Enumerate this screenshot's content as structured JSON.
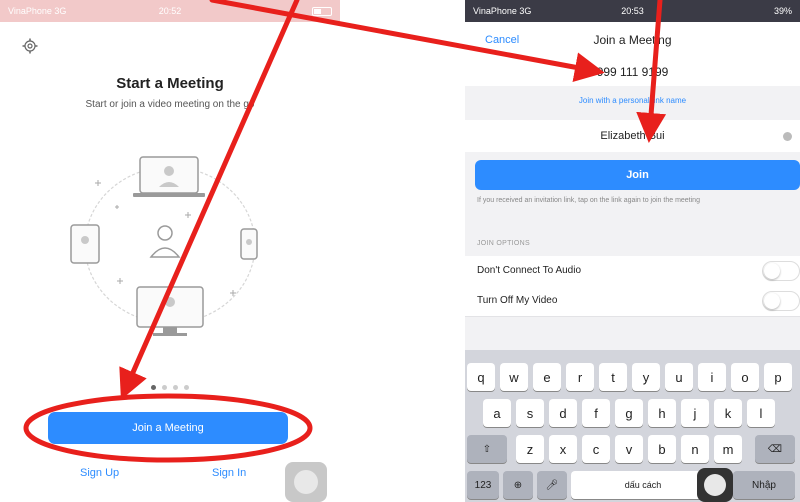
{
  "left": {
    "status": {
      "carrier": "VinaPhone 3G",
      "time": "20:52"
    },
    "title": "Start a Meeting",
    "subtitle": "Start or join a video meeting on the go",
    "pager": {
      "count": 4,
      "active": 0
    },
    "join_meeting_label": "Join a Meeting",
    "sign_up_label": "Sign Up",
    "sign_in_label": "Sign In"
  },
  "right": {
    "status": {
      "carrier": "VinaPhone 3G",
      "time": "20:53",
      "battery": "39%"
    },
    "cancel_label": "Cancel",
    "title": "Join a Meeting",
    "meeting_id": "999 111 9199",
    "personal_link_label": "Join with a personal link name",
    "name_value": "Elizabeth Bui",
    "join_label": "Join",
    "hint": "If you received an invitation link, tap on the link again to join the meeting",
    "options_header": "JOIN OPTIONS",
    "options": [
      {
        "label": "Don't Connect To Audio",
        "on": false
      },
      {
        "label": "Turn Off My Video",
        "on": false
      }
    ],
    "keyboard": {
      "row1": [
        "q",
        "w",
        "e",
        "r",
        "t",
        "y",
        "u",
        "i",
        "o",
        "p"
      ],
      "row2": [
        "a",
        "s",
        "d",
        "f",
        "g",
        "h",
        "j",
        "k",
        "l"
      ],
      "row3": [
        "z",
        "x",
        "c",
        "v",
        "b",
        "n",
        "m"
      ],
      "numbers_key": "123",
      "space_key": "dấu cách",
      "return_key": "Nhập"
    }
  },
  "colors": {
    "accent": "#2d8cff",
    "annotation": "#e8201c"
  }
}
